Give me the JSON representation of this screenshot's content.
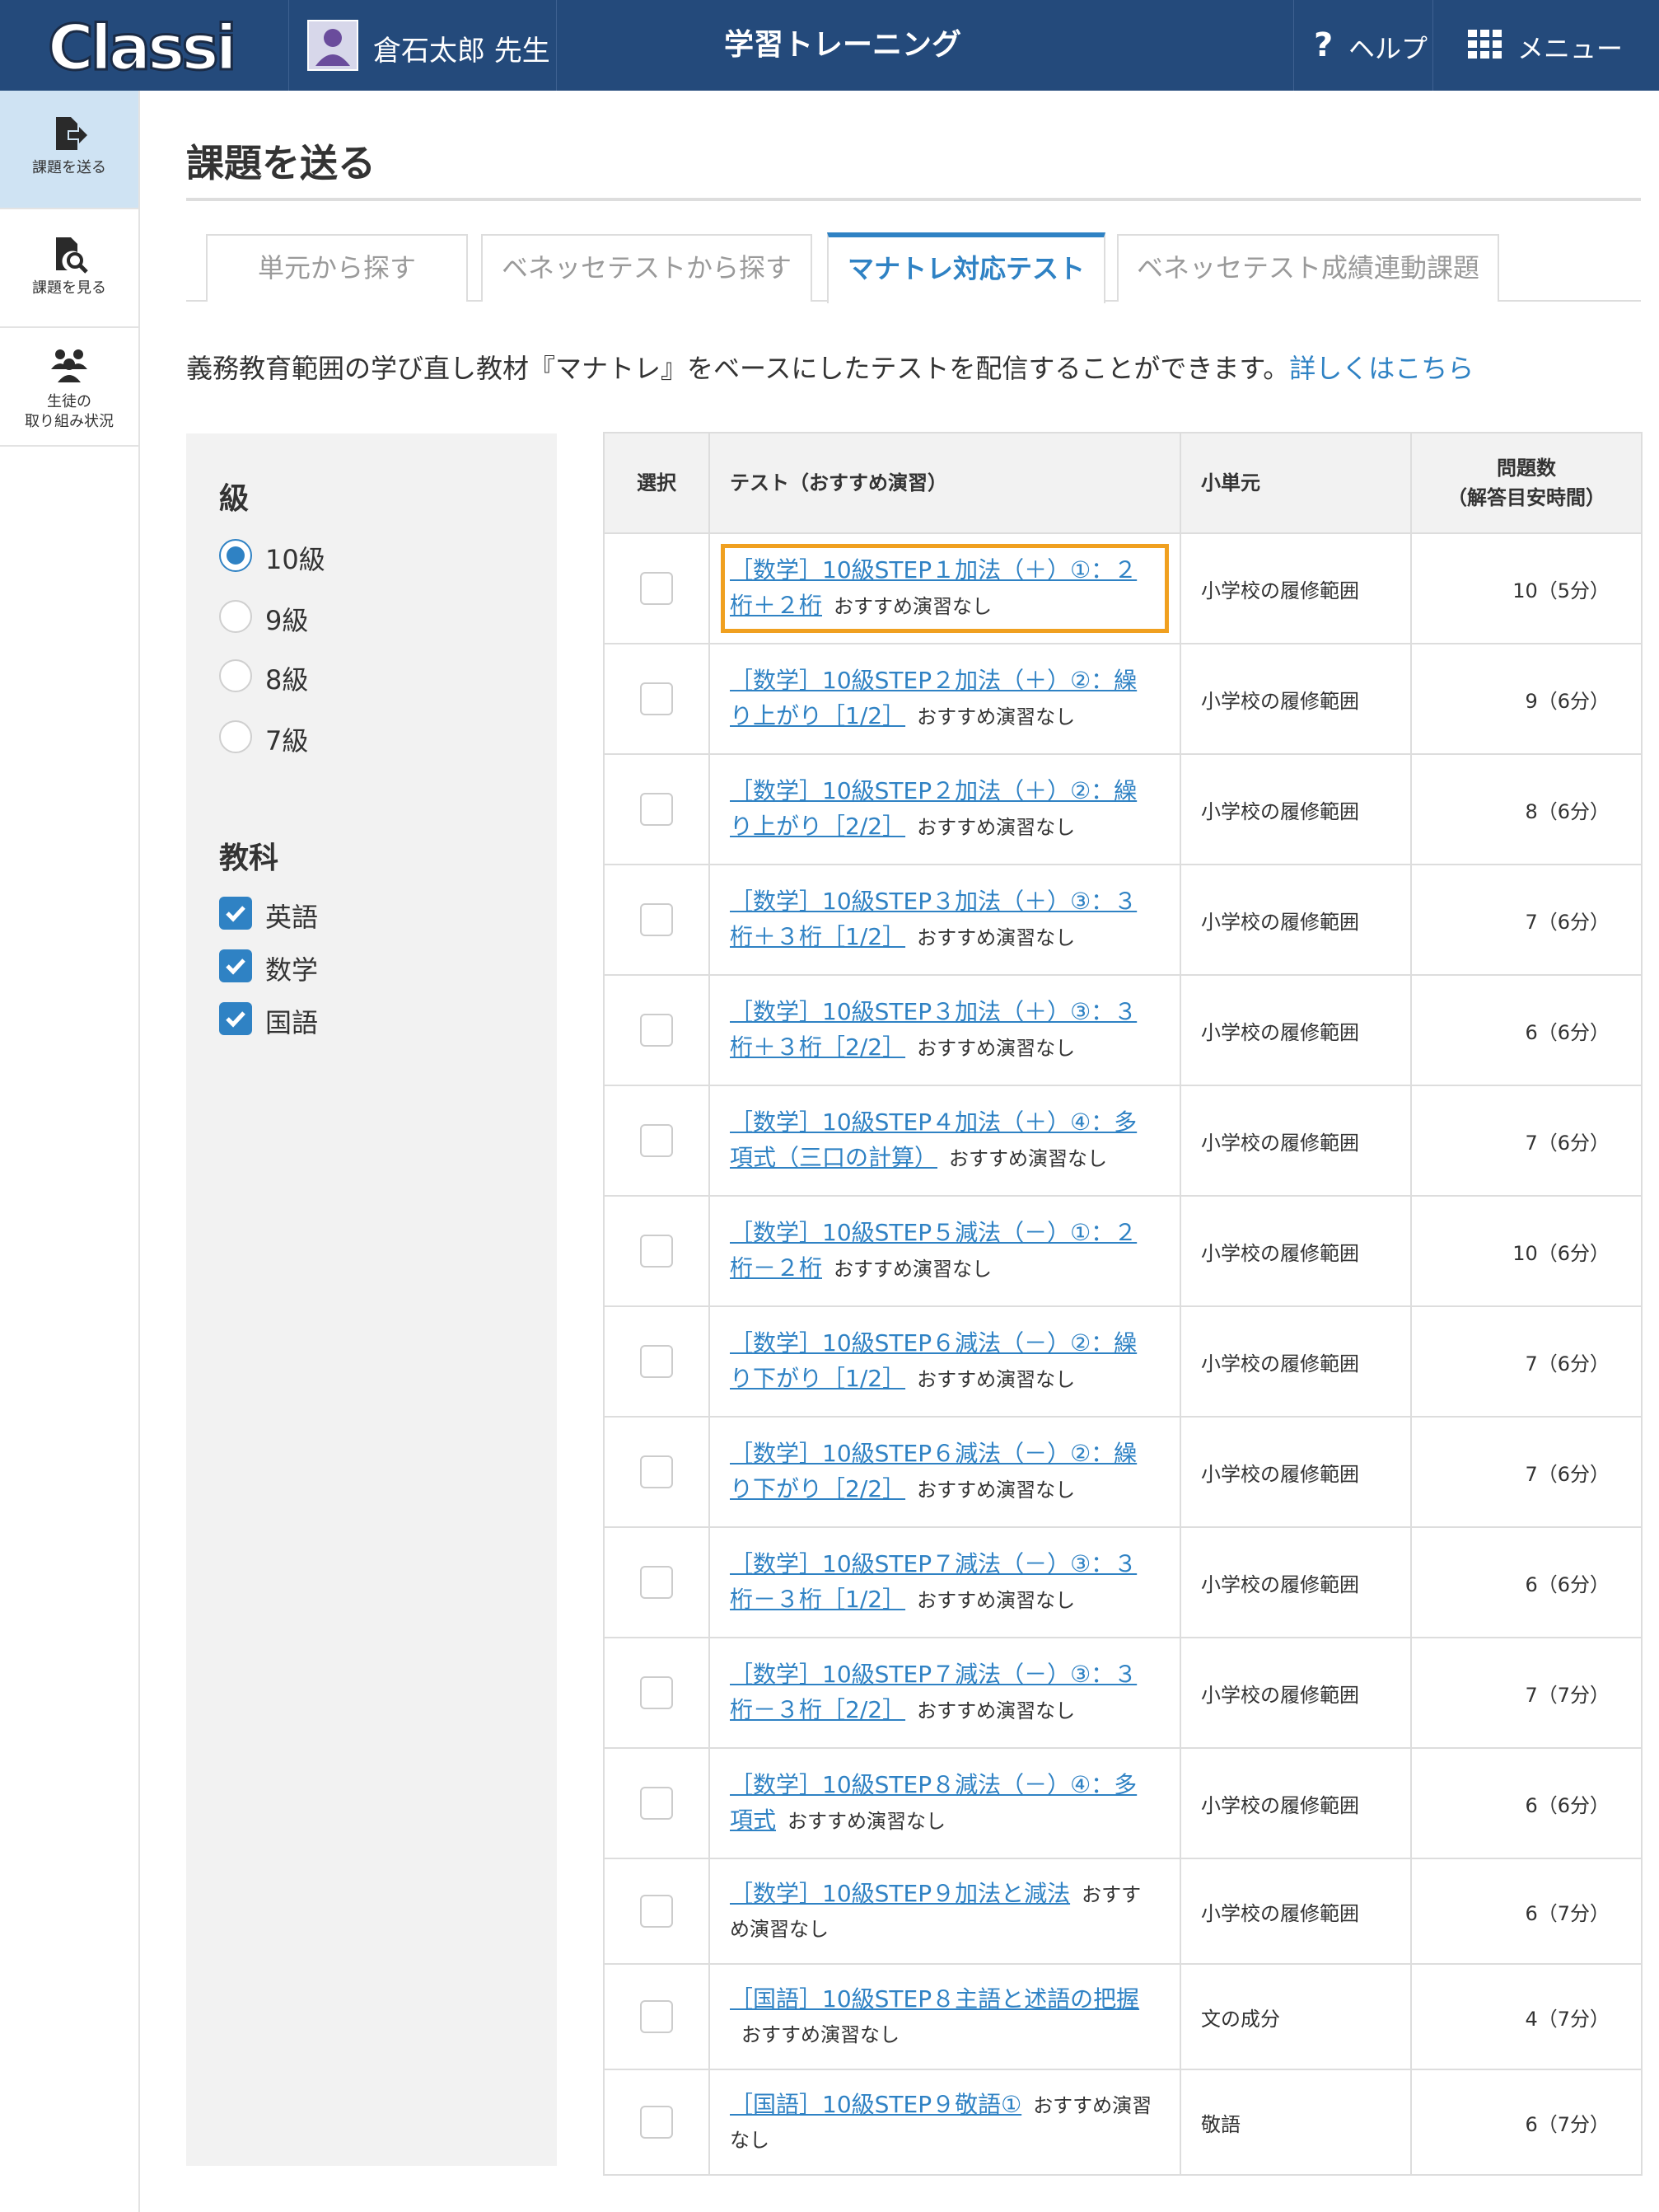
{
  "header": {
    "logo_text": "Classi",
    "user_name": "倉石太郎 先生",
    "app_title": "学習トレーニング",
    "help_label": "ヘルプ",
    "menu_label": "メニュー"
  },
  "sidebar": {
    "items": [
      {
        "label": "課題を送る",
        "icon": "send-assignment-icon"
      },
      {
        "label": "課題を見る",
        "icon": "view-assignment-icon"
      },
      {
        "label_line1": "生徒の",
        "label_line2": "取り組み状況",
        "icon": "students-icon"
      }
    ]
  },
  "page": {
    "title": "課題を送る",
    "tabs": [
      "単元から探す",
      "ベネッセテストから探す",
      "マナトレ対応テスト",
      "ベネッセテスト成績連動課題"
    ],
    "active_tab": "マナトレ対応テスト",
    "intro_text": "義務教育範囲の学び直し教材『マナトレ』をベースにしたテストを配信することができます。",
    "intro_link": "詳しくはこちら"
  },
  "filter": {
    "grade_heading": "級",
    "grades": [
      "10級",
      "9級",
      "8級",
      "7級"
    ],
    "selected_grade": "10級",
    "subject_heading": "教科",
    "subjects": [
      "英語",
      "数学",
      "国語"
    ]
  },
  "table": {
    "headers": {
      "select": "選択",
      "test": "テスト（おすすめ演習）",
      "unit": "小単元",
      "count_line1": "問題数",
      "count_line2": "（解答目安時間）"
    },
    "rows": [
      {
        "title_a": "［数学］10級STEP１加法（＋）①：２",
        "title_b": "桁＋２桁",
        "rec": "おすすめ演習なし",
        "unit": "小学校の履修範囲",
        "count": "10（5分）"
      },
      {
        "title_a": "［数学］10級STEP２加法（＋）②：繰",
        "title_b": "り上がり［1/2］",
        "rec": "おすすめ演習なし",
        "unit": "小学校の履修範囲",
        "count": "9（6分）"
      },
      {
        "title_a": "［数学］10級STEP２加法（＋）②：繰",
        "title_b": "り上がり［2/2］",
        "rec": "おすすめ演習なし",
        "unit": "小学校の履修範囲",
        "count": "8（6分）"
      },
      {
        "title_a": "［数学］10級STEP３加法（＋）③：３",
        "title_b": "桁＋３桁［1/2］",
        "rec": "おすすめ演習なし",
        "unit": "小学校の履修範囲",
        "count": "7（6分）"
      },
      {
        "title_a": "［数学］10級STEP３加法（＋）③：３",
        "title_b": "桁＋３桁［2/2］",
        "rec": "おすすめ演習なし",
        "unit": "小学校の履修範囲",
        "count": "6（6分）"
      },
      {
        "title_a": "［数学］10級STEP４加法（＋）④：多",
        "title_b": "項式（三口の計算）",
        "rec": "おすすめ演習なし",
        "unit": "小学校の履修範囲",
        "count": "7（6分）"
      },
      {
        "title_a": "［数学］10級STEP５減法（－）①：２",
        "title_b": "桁－２桁",
        "rec": "おすすめ演習なし",
        "unit": "小学校の履修範囲",
        "count": "10（6分）"
      },
      {
        "title_a": "［数学］10級STEP６減法（－）②：繰",
        "title_b": "り下がり［1/2］",
        "rec": "おすすめ演習なし",
        "unit": "小学校の履修範囲",
        "count": "7（6分）"
      },
      {
        "title_a": "［数学］10級STEP６減法（－）②：繰",
        "title_b": "り下がり［2/2］",
        "rec": "おすすめ演習なし",
        "unit": "小学校の履修範囲",
        "count": "7（6分）"
      },
      {
        "title_a": "［数学］10級STEP７減法（－）③：３",
        "title_b": "桁－３桁［1/2］",
        "rec": "おすすめ演習なし",
        "unit": "小学校の履修範囲",
        "count": "6（6分）"
      },
      {
        "title_a": "［数学］10級STEP７減法（－）③：３",
        "title_b": "桁－３桁［2/2］",
        "rec": "おすすめ演習なし",
        "unit": "小学校の履修範囲",
        "count": "7（7分）"
      },
      {
        "title_a": "［数学］10級STEP８減法（－）④：多",
        "title_b": "項式",
        "rec": "おすすめ演習なし",
        "unit": "小学校の履修範囲",
        "count": "6（6分）"
      },
      {
        "title_a": "［数学］10級STEP９加法と減法",
        "title_b": "",
        "rec": "おすすめ演習なし",
        "unit": "小学校の履修範囲",
        "count": "6（7分）"
      },
      {
        "title_a": "［国語］10級STEP８主語と述語の把握",
        "title_b": "",
        "rec": "おすすめ演習なし",
        "unit": "文の成分",
        "count": "4（7分）"
      },
      {
        "title_a": "［国語］10級STEP９敬語①",
        "title_b": "",
        "rec": "おすすめ演習なし",
        "unit": "敬語",
        "count": "6（7分）"
      }
    ]
  },
  "colors": {
    "header_bg": "#244a7b",
    "accent": "#2f82c4",
    "highlight": "#f0a020",
    "panel_bg": "#f2f2f2"
  }
}
